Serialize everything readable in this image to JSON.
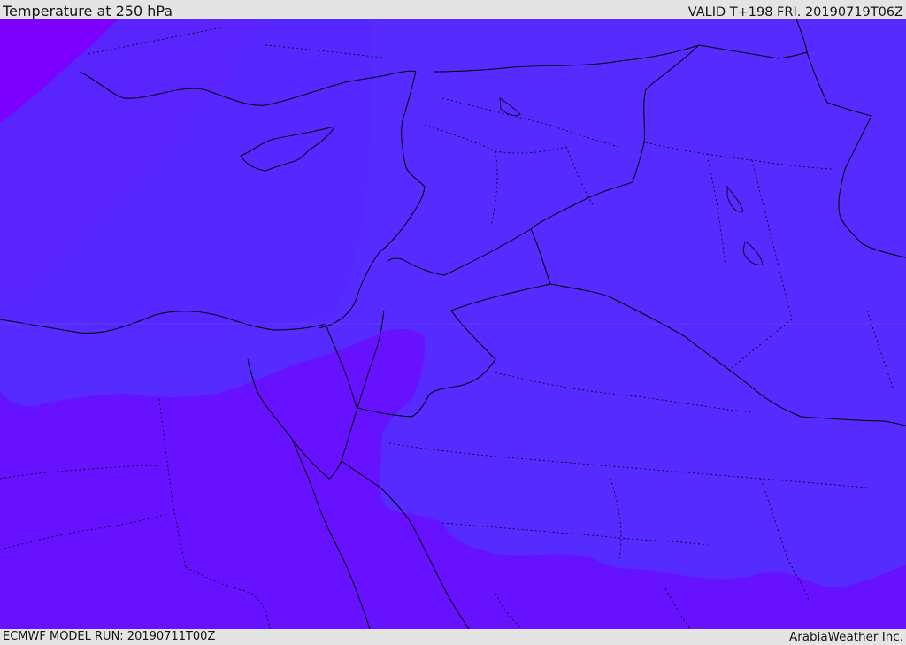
{
  "header": {
    "title": "Temperature at 250 hPa",
    "valid": "VALID T+198 FRI. 20190719T06Z"
  },
  "footer": {
    "model_run": "ECMWF MODEL RUN: 20190711T00Z",
    "brand": "ArabiaWeather Inc."
  },
  "map": {
    "field": "temperature",
    "level": "250 hPa",
    "colors": {
      "band_coldest": "#7b00ff",
      "band_cold": "#6611ff",
      "band_mild": "#5a24ff",
      "band_warm": "#552bff",
      "border_line": "#000000"
    }
  }
}
